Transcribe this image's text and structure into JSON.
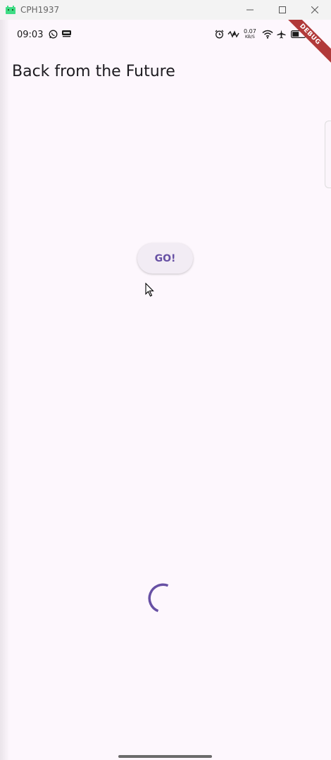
{
  "window": {
    "title": "CPH1937",
    "controls": [
      "minimize",
      "maximize",
      "close"
    ]
  },
  "status_bar": {
    "time": "09:03",
    "net_speed_value": "0.07",
    "net_speed_unit": "KB/S",
    "icons": [
      "whatsapp-icon",
      "cnn-icon",
      "alarm-icon",
      "vibrate-icon",
      "wifi-icon",
      "airplane-icon",
      "battery-icon"
    ]
  },
  "debug_banner": "DEBUG",
  "app_bar": {
    "title": "Back from the Future"
  },
  "main": {
    "go_button_label": "GO!"
  },
  "colors": {
    "background": "#fdf7fd",
    "accent": "#6750a4",
    "button_bg": "#f2ecf4",
    "debug_banner": "#b13a3a"
  }
}
